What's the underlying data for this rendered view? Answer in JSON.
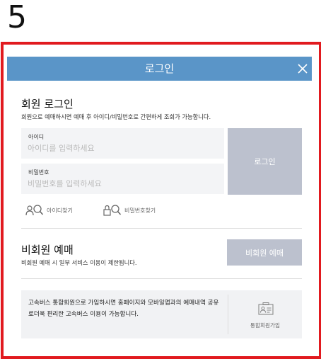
{
  "annotation": {
    "step_number": "5",
    "frame_color": "#e11a1f"
  },
  "modal": {
    "title": "로그인",
    "header_color": "#5a95c8",
    "close_icon": "close-icon"
  },
  "member_login": {
    "heading": "회원 로그인",
    "description": "회원으로 예매하시면 예매 후 아이디/비밀번호로 간편하게 조회가 가능합니다.",
    "id_field": {
      "label": "아이디",
      "placeholder": "아이디를 입력하세요",
      "value": ""
    },
    "password_field": {
      "label": "비밀번호",
      "placeholder": "비밀번호를 입력하세요",
      "value": ""
    },
    "login_button": "로그인",
    "find_id": {
      "label": "아이디찾기",
      "icon": "user-search-icon"
    },
    "find_password": {
      "label": "비밀번호찾기",
      "icon": "lock-search-icon"
    }
  },
  "guest_booking": {
    "heading": "비회원 예매",
    "description": "비회원 예매 시 일부 서비스 이용이 제한됩니다.",
    "button": "비회원 예매"
  },
  "info_banner": {
    "text": "고속버스 통합회원으로 가입하시면 홈페이지와 모바일앱과의 예매내역 공유로더욱 편리한 고속버스 이용이 가능합니다.",
    "join_label": "통합회원가입",
    "join_icon": "id-card-icon"
  },
  "colors": {
    "button_disabled": "#bcc1ce",
    "field_bg": "#f3f4f6",
    "banner_bg": "#f1f2f4"
  }
}
